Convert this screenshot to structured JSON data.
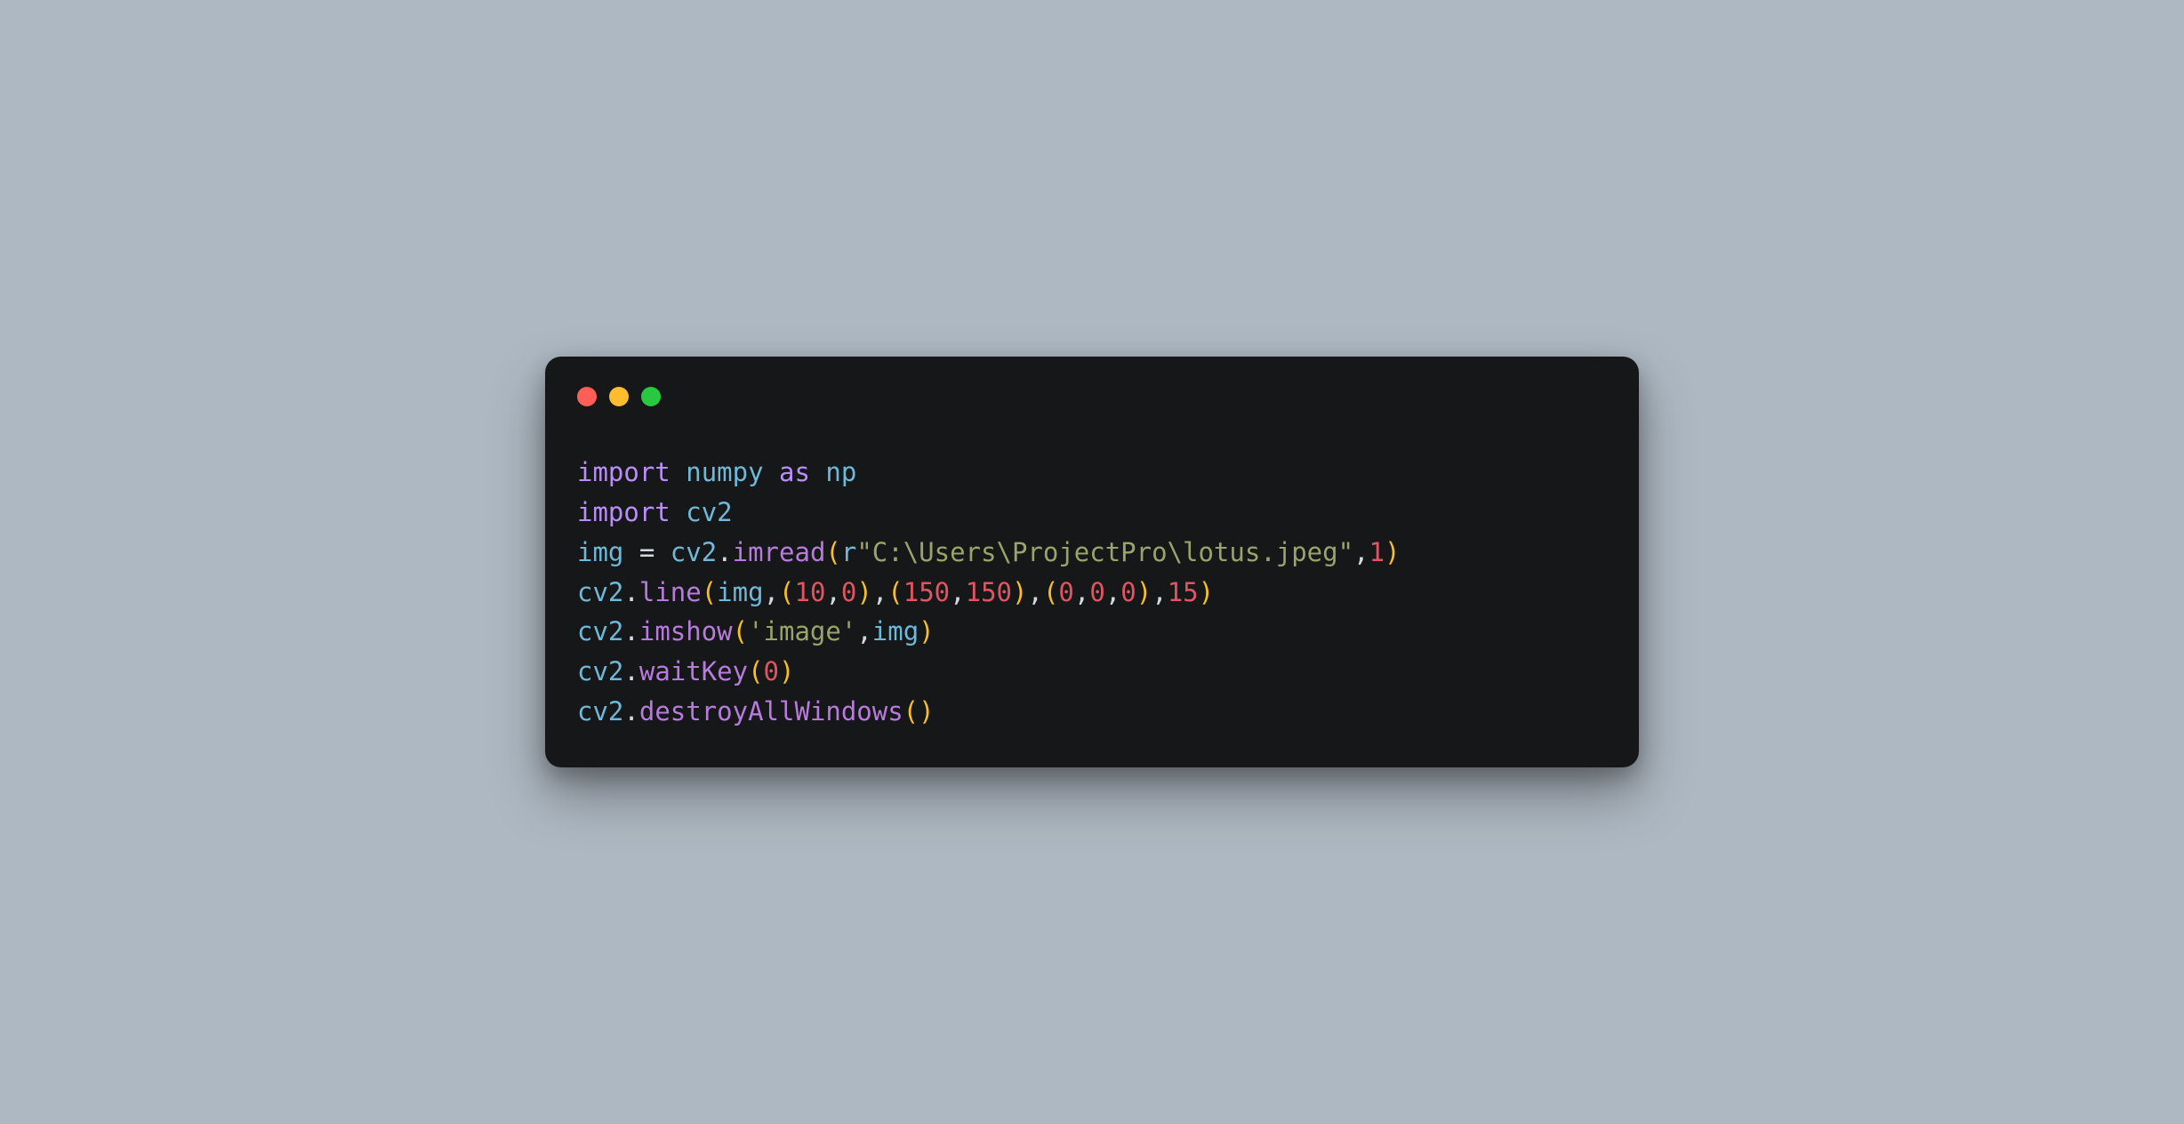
{
  "colors": {
    "background": "#aeb8c2",
    "window_bg": "#151718",
    "dot_red": "#ff5f57",
    "dot_yellow": "#febc2e",
    "dot_green": "#28c840",
    "keyword": "#ba8ef7",
    "identifier": "#6fb8d8",
    "function": "#b77bdc",
    "paren": "#fbbf24",
    "number": "#e05561",
    "string": "#9aa36a",
    "default": "#d3d9e0"
  },
  "code": {
    "line1": {
      "import": "import",
      "numpy": "numpy",
      "as": "as",
      "np": "np"
    },
    "line2": {
      "import": "import",
      "cv2": "cv2"
    },
    "line3": {
      "img": "img",
      "eq": " = ",
      "cv2": "cv2",
      "dot": ".",
      "imread": "imread",
      "lp": "(",
      "r": "r",
      "str": "\"C:\\Users\\ProjectPro\\lotus.jpeg\"",
      "comma": ",",
      "one": "1",
      "rp": ")"
    },
    "line4": {
      "cv2": "cv2",
      "dot": ".",
      "line": "line",
      "lp": "(",
      "img": "img",
      "c1": ",",
      "lp2": "(",
      "n10": "10",
      "c2": ",",
      "n0a": "0",
      "rp2": ")",
      "c3": ",",
      "lp3": "(",
      "n150a": "150",
      "c4": ",",
      "n150b": "150",
      "rp3": ")",
      "c5": ",",
      "lp4": "(",
      "n0b": "0",
      "c6": ",",
      "n0c": "0",
      "c7": ",",
      "n0d": "0",
      "rp4": ")",
      "c8": ",",
      "n15": "15",
      "rp": ")"
    },
    "line5": {
      "cv2": "cv2",
      "dot": ".",
      "imshow": "imshow",
      "lp": "(",
      "str": "'image'",
      "comma": ",",
      "img": "img",
      "rp": ")"
    },
    "line6": {
      "cv2": "cv2",
      "dot": ".",
      "waitKey": "waitKey",
      "lp": "(",
      "zero": "0",
      "rp": ")"
    },
    "line7": {
      "cv2": "cv2",
      "dot": ".",
      "destroy": "destroyAllWindows",
      "lp": "(",
      "rp": ")"
    }
  }
}
